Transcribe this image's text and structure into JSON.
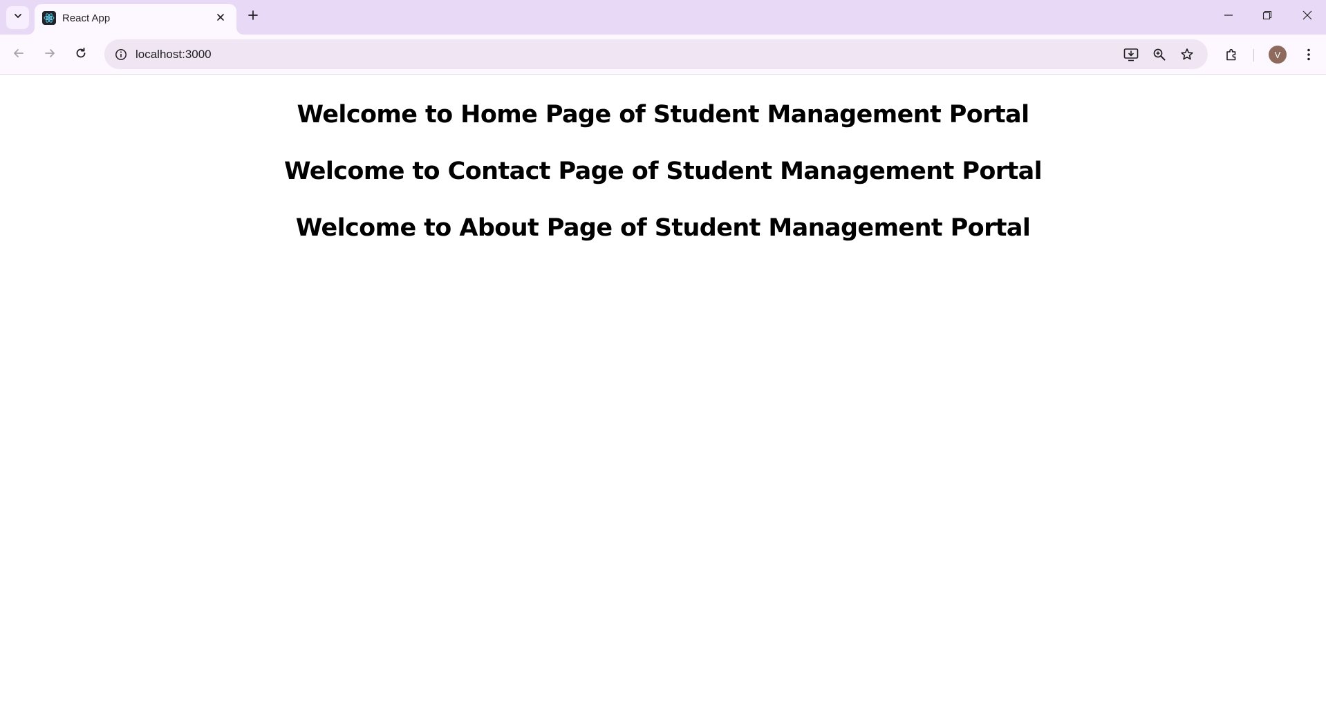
{
  "browser": {
    "tab": {
      "title": "React App",
      "favicon": "react-logo-icon"
    },
    "address_bar": {
      "url": "localhost:3000"
    },
    "profile": {
      "initial": "V",
      "color": "#8e6a5c"
    },
    "colors": {
      "tab_strip": "#e8daf6",
      "toolbar": "#fdf7ff",
      "omnibox": "#efe5f3"
    }
  },
  "page": {
    "headings": [
      "Welcome to Home Page of Student Management Portal",
      "Welcome to Contact Page of Student Management Portal",
      "Welcome to About Page of Student Management Portal"
    ]
  }
}
